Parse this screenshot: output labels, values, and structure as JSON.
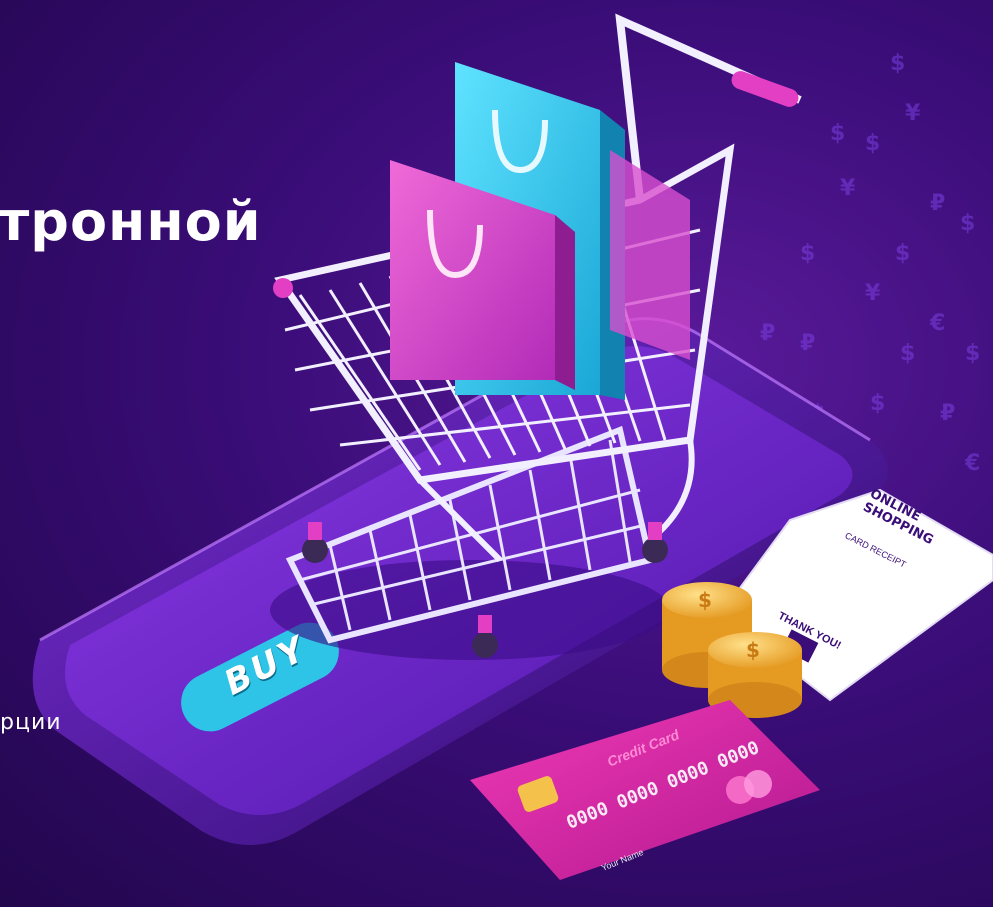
{
  "hero": {
    "headline": "тронной",
    "subline": "рции"
  },
  "phone": {
    "buy_button_label": "BUY"
  },
  "receipt": {
    "title": "ONLINE SHOPPING",
    "subtitle": "CARD RECEIPT",
    "thanks": "THANK YOU!"
  },
  "credit_card": {
    "label": "Credit Card",
    "number": "0000 0000 0000 0000",
    "name": "Your Name"
  },
  "colors": {
    "background": "#3a0d78",
    "accent_pink": "#e23fc4",
    "accent_cyan": "#2ec4e8",
    "coin_gold": "#f4b43c"
  }
}
